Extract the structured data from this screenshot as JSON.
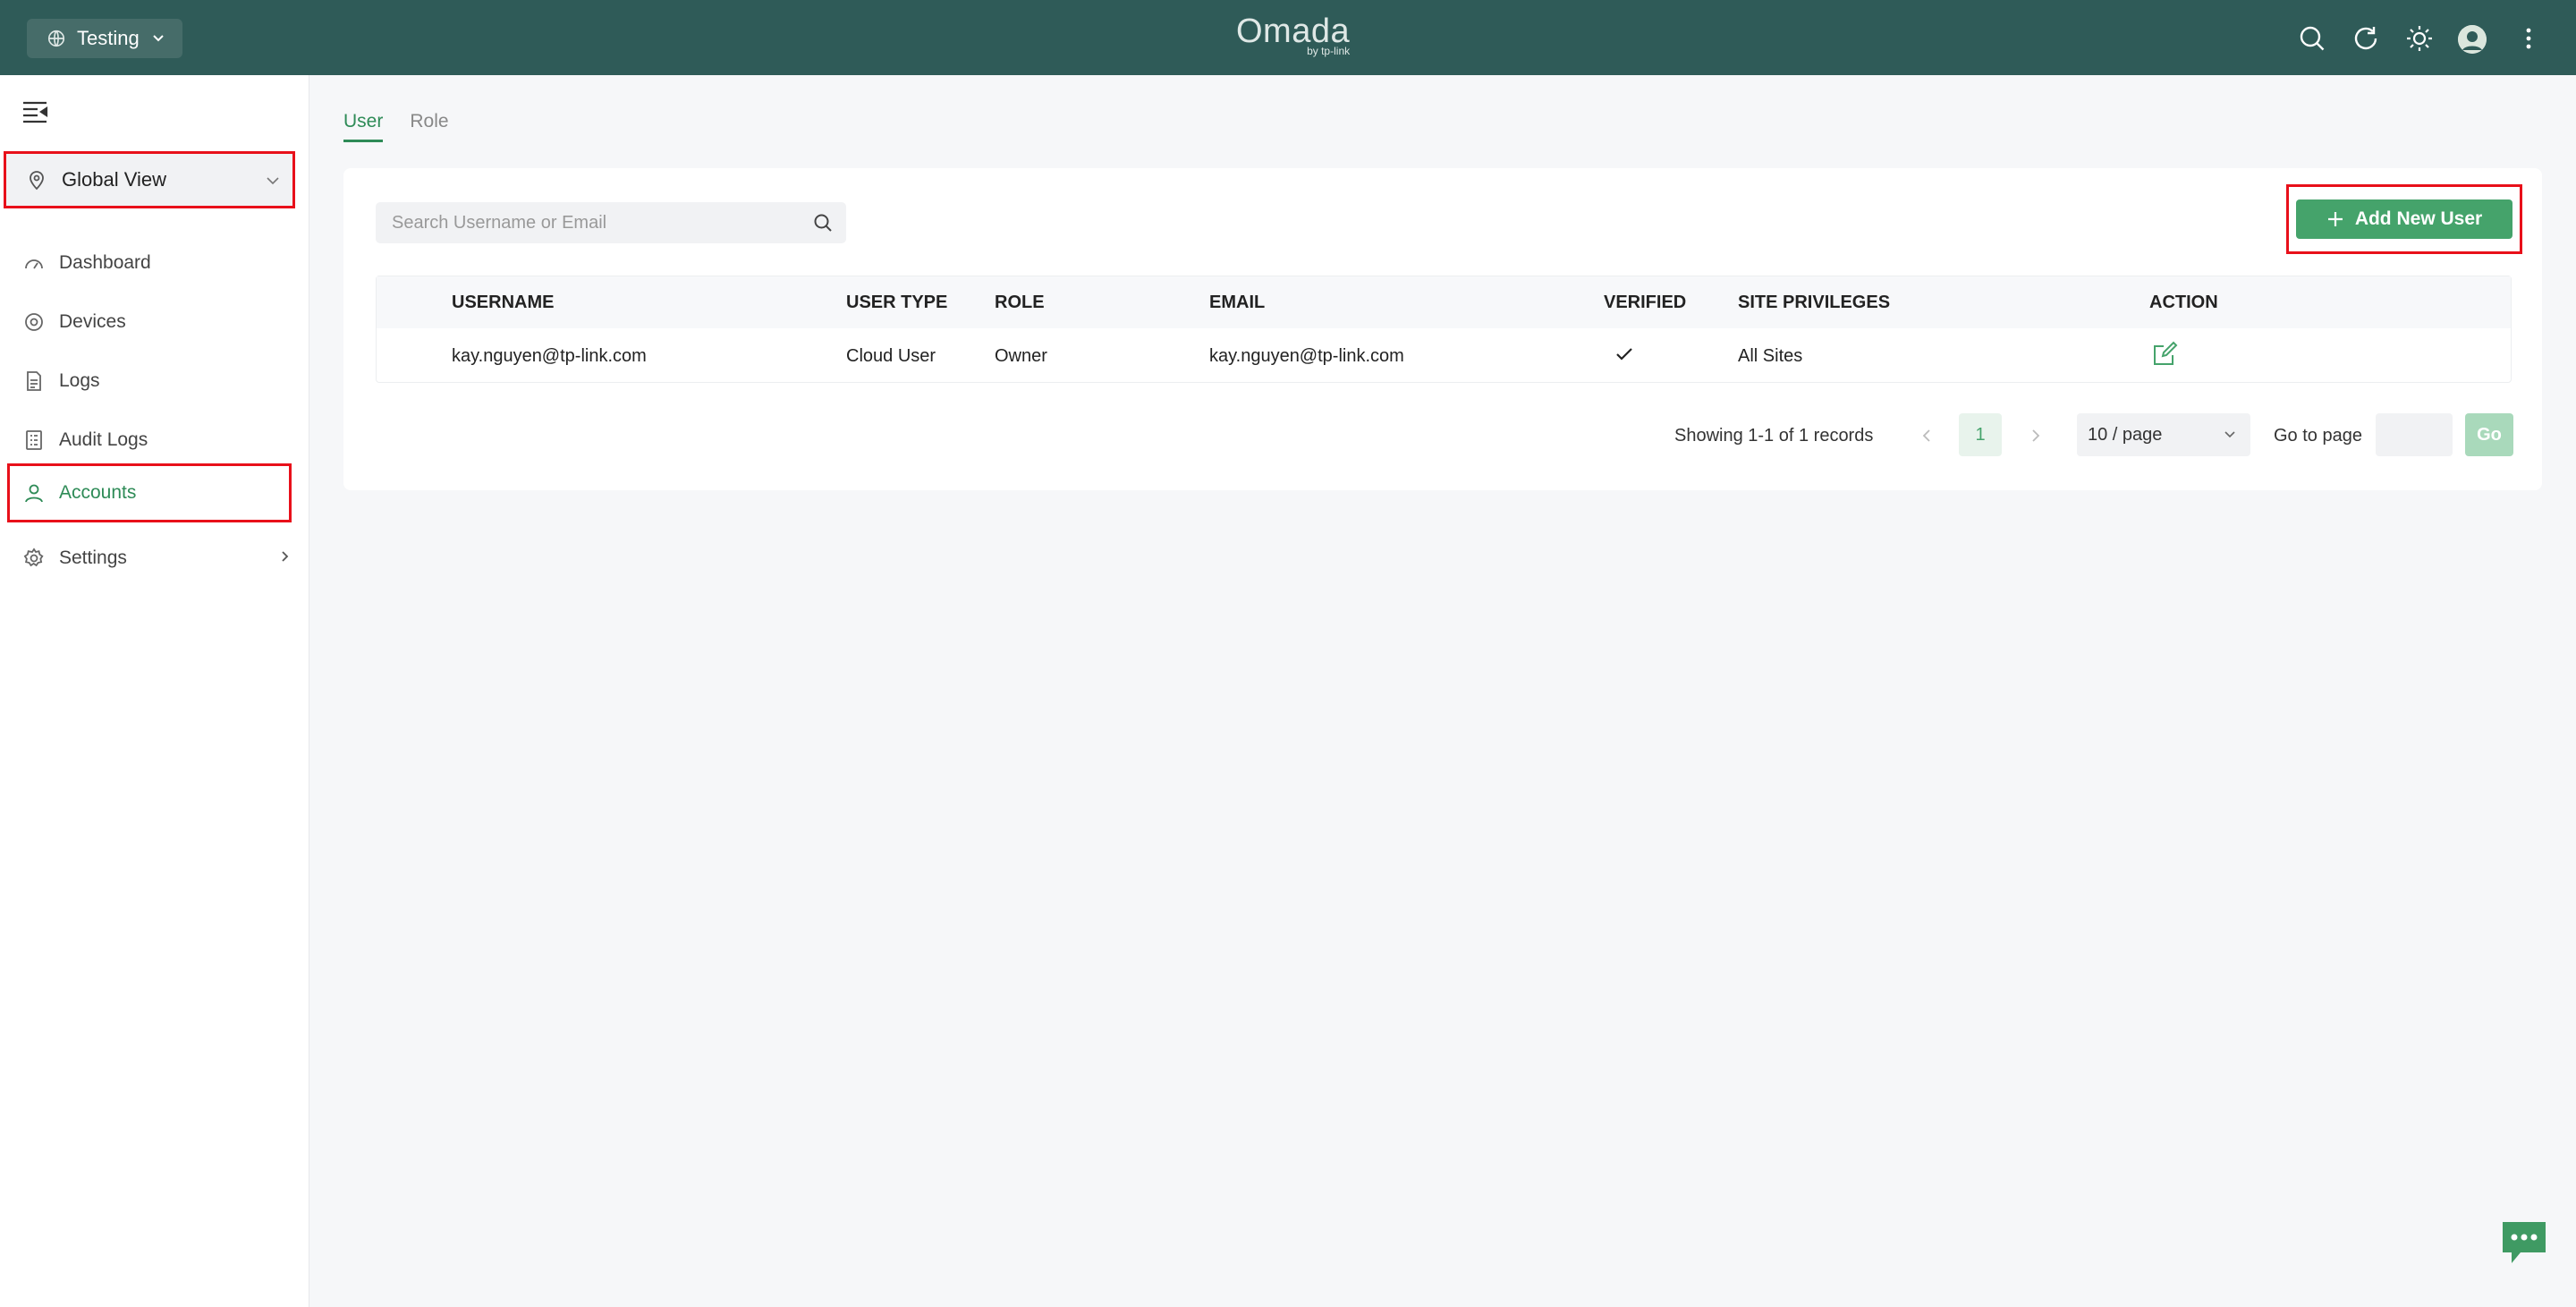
{
  "header": {
    "site_name": "Testing",
    "logo_text": "Omada",
    "logo_subtext": "by tp-link",
    "icons": [
      "search-icon",
      "refresh-icon",
      "theme-icon",
      "avatar",
      "more-icon"
    ]
  },
  "sidebar": {
    "view_select": "Global View",
    "items": [
      {
        "label": "Dashboard",
        "icon": "dashboard-icon"
      },
      {
        "label": "Devices",
        "icon": "devices-icon"
      },
      {
        "label": "Logs",
        "icon": "logs-icon"
      },
      {
        "label": "Audit Logs",
        "icon": "audit-logs-icon"
      },
      {
        "label": "Accounts",
        "icon": "user-icon",
        "active": true
      },
      {
        "label": "Settings",
        "icon": "gear-icon"
      }
    ]
  },
  "tabs": [
    {
      "label": "User",
      "active": true
    },
    {
      "label": "Role",
      "active": false
    }
  ],
  "toolbar": {
    "search_placeholder": "Search Username or Email",
    "add_label": "Add New User"
  },
  "table": {
    "columns": [
      "USERNAME",
      "USER TYPE",
      "ROLE",
      "EMAIL",
      "VERIFIED",
      "SITE PRIVILEGES",
      "ACTION"
    ],
    "rows": [
      {
        "username": "kay.nguyen@tp-link.com",
        "user_type": "Cloud User",
        "role": "Owner",
        "email": "kay.nguyen@tp-link.com",
        "verified": true,
        "site_privileges": "All Sites"
      }
    ]
  },
  "pagination": {
    "records_text": "Showing 1-1 of 1 records",
    "current_page": "1",
    "per_page": "10 / page",
    "goto_label": "Go to page",
    "go_label": "Go"
  },
  "colors": {
    "topbar": "#2f5b58",
    "accent": "#45a36b",
    "highlight": "#e8101a"
  }
}
